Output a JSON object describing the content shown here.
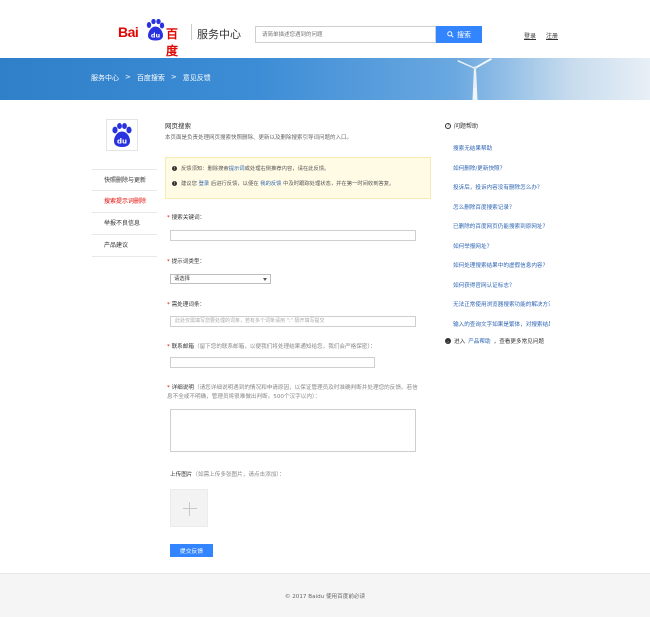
{
  "header": {
    "logo_text_left": "Bai",
    "logo_badge": "du",
    "logo_text_right": "百度",
    "service_title": "服务中心",
    "search_placeholder": "请简单描述您遇到的问题",
    "search_button": "搜索",
    "login": "登录",
    "register": "注册"
  },
  "breadcrumb": [
    "服务中心",
    ">",
    "百度搜索",
    ">",
    "意见反馈"
  ],
  "sidebar": {
    "items": [
      {
        "label": "快照删除与更新",
        "active": false
      },
      {
        "label": "搜索提示词删除",
        "active": true
      },
      {
        "label": "举报不良信息",
        "active": false
      },
      {
        "label": "产品建议",
        "active": false
      }
    ]
  },
  "main": {
    "section_title": "网页搜索",
    "section_desc": "本页面是负责处理网页搜索快照删除、更新以及删除搜索引导词问题的入口。",
    "notice": {
      "line1_prefix": "反馈须知：删除搜索",
      "line1_link": "提示词",
      "line1_suffix": "或处理右侧推荐内容，请在此反馈。",
      "line2_prefix": "建议您",
      "line2_login": "登录",
      "line2_mid": "后进行反馈，以便在",
      "line2_link": "我的反馈",
      "line2_suffix": "中及时跟踪处理状态，并在第一时间收到答复。"
    },
    "keyword_label": "搜索关键词：",
    "type_label": "提示词类型：",
    "type_selected": "请选择",
    "words_label": "需处理词条：",
    "words_placeholder": "此处仅需填写您要处理的词条，若有多个词条请用 \";\" 隔开填写提交",
    "email_label": "联系邮箱",
    "email_hint": "（留下您的联系邮箱，以便我们将处理结果通知给您，我们会严格保密）：",
    "detail_label": "详细说明",
    "detail_hint": "（请您详细说明遇到的情况和申请原因，以保证管理员及时准确判断并处理您的反馈。若信息不全或不明确，管理员将很难做出判断。500个汉字以内）：",
    "upload_label": "上传图片",
    "upload_hint": "（如需上传多张图片，请点击添加）：",
    "submit": "提交反馈"
  },
  "help": {
    "title": "问题帮助",
    "items": [
      "搜索无结果帮助",
      "如何删除/更新快照？",
      "投诉后，投诉内容没有删除怎么办？",
      "怎么删除百度搜索记录？",
      "已删除的百度网页仍能搜索到原网址？",
      "如何举报网址？",
      "如何处理搜索结果中的虚假信息内容？",
      "如何获得官网认证标志？",
      "无法正常使用浏览器搜索功能的解决方法",
      "输入的查询文字如果是繁体，对搜索结果"
    ],
    "more_prefix": "进入",
    "more_link": "产品帮助",
    "more_suffix": "，查看更多常见问题"
  },
  "footer": {
    "text": "© 2017 Baidu 使用百度前必读"
  },
  "colors": {
    "brand_red": "#e10602",
    "brand_blue": "#3385ff",
    "link_blue": "#2d64b3"
  }
}
